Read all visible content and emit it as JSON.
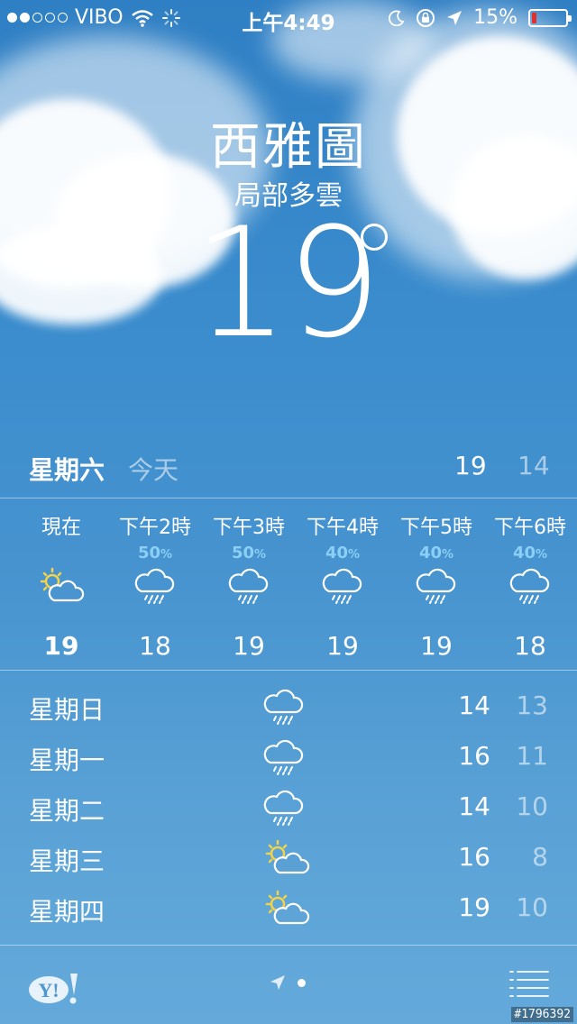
{
  "status_bar": {
    "carrier": "VIBO",
    "time": "上午4:49",
    "battery": "15%",
    "battery_level": 0.15,
    "signal_dots_filled": 2,
    "signal_dots_total": 5
  },
  "header": {
    "city": "西雅圖",
    "condition": "局部多雲",
    "temperature": "19"
  },
  "today": {
    "day": "星期六",
    "label": "今天",
    "high": "19",
    "low": "14"
  },
  "hourly": [
    {
      "time": "現在",
      "pop": "",
      "icon": "partly-cloudy-icon",
      "temp": "19"
    },
    {
      "time": "下午2時",
      "pop": "50",
      "icon": "rain-cloud-icon",
      "temp": "18"
    },
    {
      "time": "下午3時",
      "pop": "50",
      "icon": "rain-cloud-icon",
      "temp": "19"
    },
    {
      "time": "下午4時",
      "pop": "40",
      "icon": "rain-cloud-icon",
      "temp": "19"
    },
    {
      "time": "下午5時",
      "pop": "40",
      "icon": "rain-cloud-icon",
      "temp": "19"
    },
    {
      "time": "下午6時",
      "pop": "40",
      "icon": "rain-cloud-icon",
      "temp": "18"
    }
  ],
  "pop_unit": "%",
  "daily": [
    {
      "day": "星期日",
      "icon": "rain-cloud-icon",
      "high": "14",
      "low": "13"
    },
    {
      "day": "星期一",
      "icon": "rain-cloud-icon",
      "high": "16",
      "low": "11"
    },
    {
      "day": "星期二",
      "icon": "rain-cloud-icon",
      "high": "14",
      "low": "10"
    },
    {
      "day": "星期三",
      "icon": "partly-cloudy-icon",
      "high": "16",
      "low": "8"
    },
    {
      "day": "星期四",
      "icon": "partly-cloudy-icon",
      "high": "19",
      "low": "10"
    }
  ],
  "footer": {
    "yahoo_logo": "Y!",
    "watermark": "#1796392"
  },
  "colors": {
    "sky_top": "#2f7fc4",
    "sky_bottom": "#64a9da",
    "precip": "#8ccff5",
    "sun": "#f3d34a",
    "battery_low": "#e03030"
  }
}
